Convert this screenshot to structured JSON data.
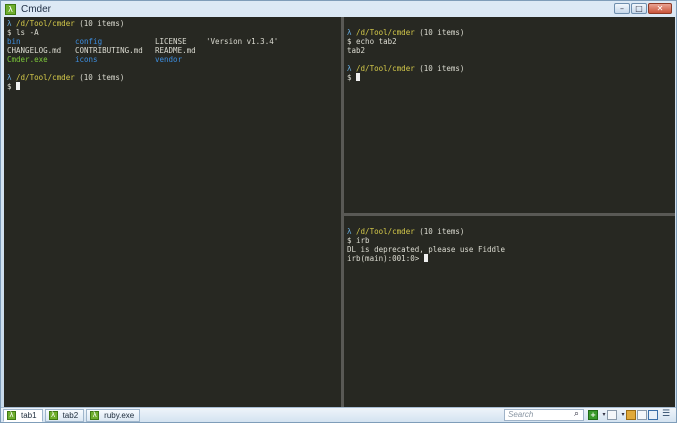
{
  "window": {
    "title": "Cmder",
    "app_icon": "λ",
    "minimize": "–",
    "maximize": "□",
    "close": "✕"
  },
  "panes": {
    "left": {
      "prompt1_lambda": "λ",
      "prompt1_path": "/d/Tool/cmder",
      "prompt1_count": "(10 items)",
      "cmd1": "$ ls -A",
      "ls_rows": [
        [
          "bin",
          "config",
          "LICENSE",
          "'Version v1.3.4'"
        ],
        [
          "CHANGELOG.md",
          "CONTRIBUTING.md",
          "README.md",
          ""
        ],
        [
          "Cmder.exe",
          "icons",
          "vendor",
          ""
        ]
      ],
      "prompt2_lambda": "λ",
      "prompt2_path": "/d/Tool/cmder",
      "prompt2_count": "(10 items)",
      "cmd2": "$ "
    },
    "top_right": {
      "prompt1_lambda": "λ",
      "prompt1_path": "/d/Tool/cmder",
      "prompt1_count": "(10 items)",
      "cmd1": "$ echo tab2",
      "output1": "tab2",
      "prompt2_lambda": "λ",
      "prompt2_path": "/d/Tool/cmder",
      "prompt2_count": "(10 items)",
      "cmd2": "$ "
    },
    "bottom_right": {
      "prompt1_lambda": "λ",
      "prompt1_path": "/d/Tool/cmder",
      "prompt1_count": "(10 items)",
      "cmd1": "$ irb",
      "output1": "DL is deprecated, please use Fiddle",
      "irb_prompt": "irb(main):001:0> "
    }
  },
  "statusbar": {
    "tabs": [
      {
        "label": "tab1",
        "active": true
      },
      {
        "label": "tab2",
        "active": false
      },
      {
        "label": "ruby.exe",
        "active": false
      }
    ],
    "tab_icon": "λ",
    "search_placeholder": "Search",
    "search_icon": "⌕",
    "new_console_icon": "+",
    "dropdown_icon": "▾",
    "menu_icon": "☰"
  }
}
